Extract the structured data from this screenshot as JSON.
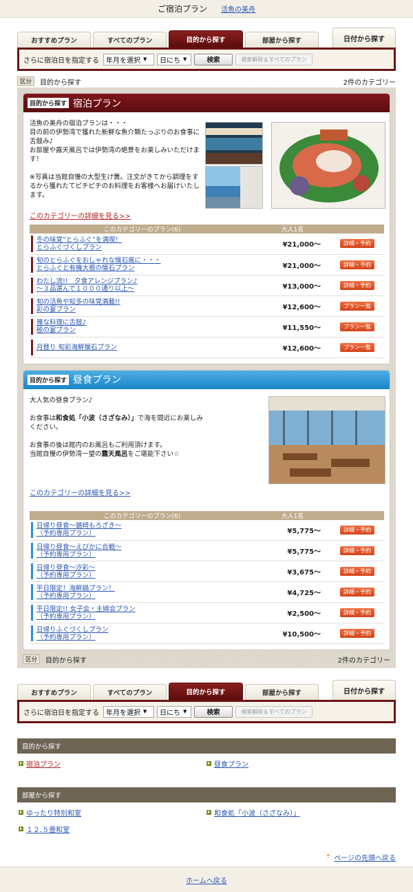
{
  "header": {
    "title": "ご宿泊プラン",
    "link": "活魚の美舟"
  },
  "tabs": [
    {
      "label": "おすすめプラン"
    },
    {
      "label": "すべてのプラン"
    },
    {
      "label": "目的から探す",
      "active": true
    },
    {
      "label": "部屋から探す"
    }
  ],
  "date_tab": "日付から探す",
  "search": {
    "label": "さらに宿泊日を指定する",
    "month": "年月を選択",
    "day": "日にち",
    "button": "検索",
    "clear": "検索解除＆すべてのプラン"
  },
  "kubun": {
    "tag": "区分",
    "label": "目的から探す",
    "count": "2件のカテゴリー"
  },
  "categories": [
    {
      "tag": "目的から探す",
      "title": "宿泊プラン",
      "color": "#6a1414",
      "p1": "活魚の美舟の宿泊プランは・・・\n目の前の伊勢湾で獲れた新鮮な魚介類たっぷりのお食事に舌鼓み♪\nお部屋や露天風呂では伊勢湾の絶景をお楽しみいただけます！",
      "p2": "※写真は当館自慢の大型生け簀。注文がきてから調理をするから獲れたてピチピチのお料理をお客様へお届けいたします。",
      "detail": "このカテゴリーの詳細を見る>>",
      "col_plans": "このカテゴリーのプラン(6)",
      "col_price": "大人1名",
      "plans": [
        {
          "l1": "冬の味覚”とらふぐ”を満喫！",
          "l2": "とらふぐづくしプラン",
          "price": "¥21,000～",
          "btn": "詳細・予約"
        },
        {
          "l1": "旬のとらふぐをおしゃれな懐石風に・・・",
          "l2": "とらふぐと有機大根の懐石プラン",
          "price": "¥21,000～",
          "btn": "詳細・予約"
        },
        {
          "l1": "わたし流!!　夕食アレンジプラン♪",
          "l2": "～３品選んで１０００通り以上～",
          "price": "¥13,000～",
          "btn": "詳細・予約"
        },
        {
          "l1": "旬の活魚や知多の味覚満載!!",
          "l2": "彩の宴プラン",
          "price": "¥12,600～",
          "btn": "プラン一覧"
        },
        {
          "l1": "雅な料理に舌鼓♪",
          "l2": "極の宴プラン",
          "price": "¥11,550～",
          "btn": "プラン一覧"
        },
        {
          "l1": "月替り 旬彩海鮮懐石プラン",
          "l2": "",
          "price": "¥12,600～",
          "btn": "プラン一覧"
        }
      ]
    },
    {
      "tag": "目的から探す",
      "title": "昼食プラン",
      "color": "#1a86c8",
      "p1": "大人気の昼食プラン♪",
      "p2_a": "お食事は",
      "p2_b": "和食処「小波（さざなみ）」",
      "p2_c": "で海を間近にお楽しみください。",
      "p3_a": "お食事の後は館内のお風呂もご利用頂けます。\n当館自慢の伊勢湾一望の",
      "p3_b": "露天風呂",
      "p3_c": "をご堪能下さい☆",
      "detail": "このカテゴリーの詳細を見る>>",
      "col_plans": "このカテゴリーのプラン(6)",
      "col_price": "大人1名",
      "plans": [
        {
          "l1": "日帰り昼食～鏡崎もろざき～",
          "l2": "（予約専用プラン）",
          "price": "¥5,775～",
          "btn": "詳細・予約"
        },
        {
          "l1": "日帰り昼食～えびかに合戦～",
          "l2": "（予約専用プラン）",
          "price": "¥5,775～",
          "btn": "詳細・予約"
        },
        {
          "l1": "日帰り昼食～汐彩～",
          "l2": "（予約専用プラン）",
          "price": "¥3,675～",
          "btn": "詳細・予約"
        },
        {
          "l1": "平日限定！海鮮鍋プラン！",
          "l2": "（予約専用プラン）",
          "price": "¥4,725～",
          "btn": "詳細・予約"
        },
        {
          "l1": "平日限定!! 女子会・主婦会プラン",
          "l2": "（予約専用プラン）",
          "price": "¥2,500～",
          "btn": "詳細・予約"
        },
        {
          "l1": "日帰りふぐづくしプラン",
          "l2": "（予約専用プラン）",
          "price": "¥10,500～",
          "btn": "詳細・予約"
        }
      ]
    }
  ],
  "purpose_box": {
    "title": "目的から探す",
    "links": [
      "宿泊プラン",
      "昼食プラン"
    ]
  },
  "room_box": {
    "title": "部屋から探す",
    "links": [
      "ゆったり特別和室",
      "和食処「小波（さざなみ）」",
      "１２.５畳和室"
    ]
  },
  "pagetop": "ページの先頭へ戻る",
  "footer": "ホームへ戻る"
}
